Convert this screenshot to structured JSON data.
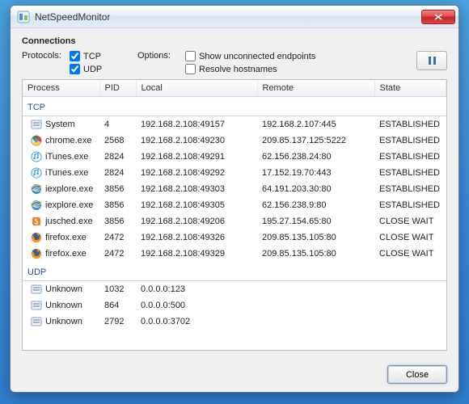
{
  "window": {
    "title": "NetSpeedMonitor"
  },
  "header": {
    "section": "Connections",
    "protocols_label": "Protocols:",
    "options_label": "Options:",
    "tcp_label": "TCP",
    "udp_label": "UDP",
    "show_unconnected_label": "Show unconnected endpoints",
    "resolve_hostnames_label": "Resolve hostnames",
    "tcp_checked": true,
    "udp_checked": true,
    "show_unconnected_checked": false,
    "resolve_hostnames_checked": false
  },
  "columns": {
    "process": "Process",
    "pid": "PID",
    "local": "Local",
    "remote": "Remote",
    "state": "State"
  },
  "groups": {
    "tcp": "TCP",
    "udp": "UDP"
  },
  "tcp_rows": [
    {
      "icon": "app",
      "process": "System",
      "pid": "4",
      "local": "192.168.2.108:49157",
      "remote": "192.168.2.107:445",
      "state": "ESTABLISHED"
    },
    {
      "icon": "chrome",
      "process": "chrome.exe",
      "pid": "2568",
      "local": "192.168.2.108:49230",
      "remote": "209.85.137.125:5222",
      "state": "ESTABLISHED"
    },
    {
      "icon": "itunes",
      "process": "iTunes.exe",
      "pid": "2824",
      "local": "192.168.2.108:49291",
      "remote": "62.156.238.24:80",
      "state": "ESTABLISHED"
    },
    {
      "icon": "itunes",
      "process": "iTunes.exe",
      "pid": "2824",
      "local": "192.168.2.108:49292",
      "remote": "17.152.19.70:443",
      "state": "ESTABLISHED"
    },
    {
      "icon": "ie",
      "process": "iexplore.exe",
      "pid": "3856",
      "local": "192.168.2.108:49303",
      "remote": "64.191.203.30:80",
      "state": "ESTABLISHED"
    },
    {
      "icon": "ie",
      "process": "iexplore.exe",
      "pid": "3856",
      "local": "192.168.2.108:49305",
      "remote": "62.156.238.9:80",
      "state": "ESTABLISHED"
    },
    {
      "icon": "java",
      "process": "jusched.exe",
      "pid": "3856",
      "local": "192.168.2.108:49206",
      "remote": "195.27.154.65:80",
      "state": "CLOSE WAIT"
    },
    {
      "icon": "firefox",
      "process": "firefox.exe",
      "pid": "2472",
      "local": "192.168.2.108:49326",
      "remote": "209.85.135.105:80",
      "state": "CLOSE WAIT"
    },
    {
      "icon": "firefox",
      "process": "firefox.exe",
      "pid": "2472",
      "local": "192.168.2.108:49329",
      "remote": "209.85.135.105:80",
      "state": "CLOSE WAIT"
    }
  ],
  "udp_rows": [
    {
      "icon": "app",
      "process": "Unknown",
      "pid": "1032",
      "local": "0.0.0.0:123",
      "remote": "",
      "state": ""
    },
    {
      "icon": "app",
      "process": "Unknown",
      "pid": "864",
      "local": "0.0.0.0:500",
      "remote": "",
      "state": ""
    },
    {
      "icon": "app",
      "process": "Unknown",
      "pid": "2792",
      "local": "0.0.0.0:3702",
      "remote": "",
      "state": ""
    }
  ],
  "footer": {
    "close": "Close"
  }
}
